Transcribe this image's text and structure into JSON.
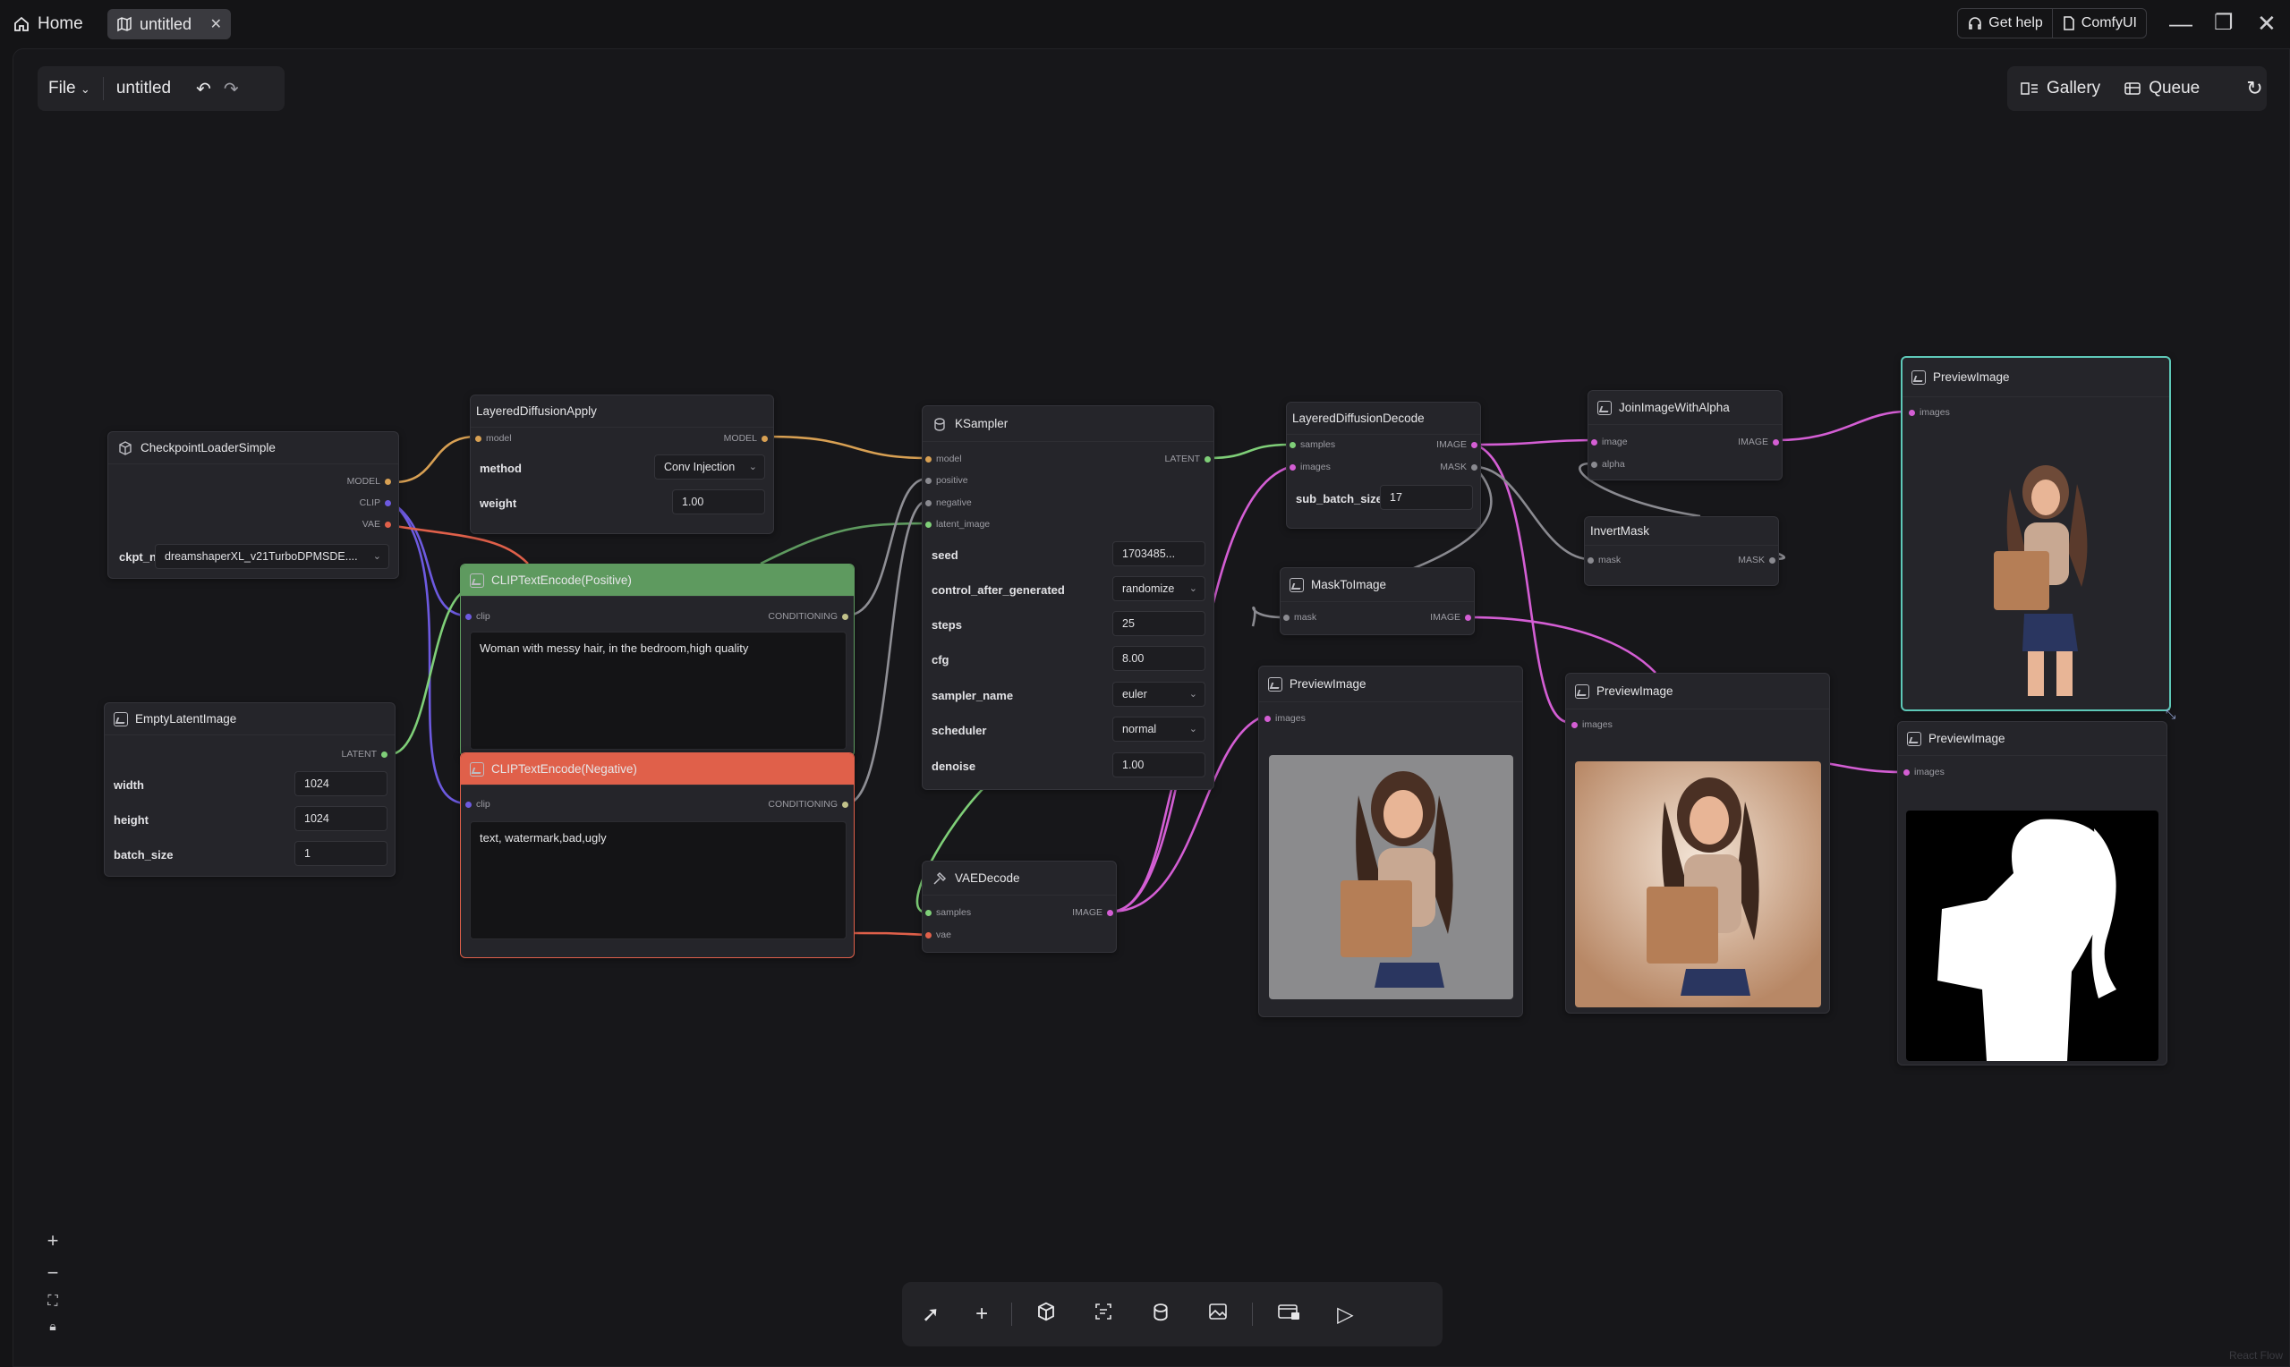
{
  "titlebar": {
    "home": "Home",
    "tab": "untitled",
    "help": "Get help",
    "app": "ComfyUI"
  },
  "menubar": {
    "file": "File",
    "workflow": "untitled"
  },
  "rightbar": {
    "gallery": "Gallery",
    "queue": "Queue"
  },
  "nodes": {
    "checkpoint": {
      "title": "CheckpointLoaderSimple",
      "out_model": "MODEL",
      "out_clip": "CLIP",
      "out_vae": "VAE",
      "widget": "ckpt_na",
      "value": "dreamshaperXL_v21TurboDPMSDE...."
    },
    "latent": {
      "title": "EmptyLatentImage",
      "out": "LATENT",
      "width_l": "width",
      "width": "1024",
      "height_l": "height",
      "height": "1024",
      "batch_l": "batch_size",
      "batch": "1"
    },
    "ldapply": {
      "title": "LayeredDiffusionApply",
      "in": "model",
      "out": "MODEL",
      "method_l": "method",
      "method": "Conv Injection",
      "weight_l": "weight",
      "weight": "1.00"
    },
    "pos": {
      "title": "CLIPTextEncode(Positive)",
      "in": "clip",
      "out": "CONDITIONING",
      "text": "Woman with messy hair, in the bedroom,high quality"
    },
    "neg": {
      "title": "CLIPTextEncode(Negative)",
      "in": "clip",
      "out": "CONDITIONING",
      "text": "text, watermark,bad,ugly"
    },
    "ksampler": {
      "title": "KSampler",
      "in_model": "model",
      "in_pos": "positive",
      "in_neg": "negative",
      "in_latent": "latent_image",
      "out": "LATENT",
      "seed_l": "seed",
      "seed": "1703485...",
      "ctrl_l": "control_after_generated",
      "ctrl": "randomize",
      "steps_l": "steps",
      "steps": "25",
      "cfg_l": "cfg",
      "cfg": "8.00",
      "sampler_l": "sampler_name",
      "sampler": "euler",
      "sched_l": "scheduler",
      "sched": "normal",
      "denoise_l": "denoise",
      "denoise": "1.00"
    },
    "vaedecode": {
      "title": "VAEDecode",
      "in_samples": "samples",
      "in_vae": "vae",
      "out": "IMAGE"
    },
    "lddecode": {
      "title": "LayeredDiffusionDecode",
      "in_samples": "samples",
      "in_images": "images",
      "out_image": "IMAGE",
      "out_mask": "MASK",
      "sub_l": "sub_batch_size",
      "sub": "17"
    },
    "masktoimage": {
      "title": "MaskToImage",
      "in": "mask",
      "out": "IMAGE"
    },
    "join": {
      "title": "JoinImageWithAlpha",
      "in_image": "image",
      "in_alpha": "alpha",
      "out": "IMAGE"
    },
    "invert": {
      "title": "InvertMask",
      "in": "mask",
      "out": "MASK"
    },
    "preview1": {
      "title": "PreviewImage",
      "in": "images"
    },
    "preview2": {
      "title": "PreviewImage",
      "in": "images"
    },
    "preview3": {
      "title": "PreviewImage",
      "in": "images"
    },
    "preview4": {
      "title": "PreviewImage",
      "in": "images"
    }
  },
  "colors": {
    "positive": "#5e9a5f",
    "negative": "#e0604a",
    "model": "#d8a053",
    "clip": "#6d5ae0",
    "vae": "#e0604a",
    "latent": "#7fcf78",
    "image": "#d45ed4",
    "mask": "#8a8a90",
    "conditioning": "#c2c28a",
    "selection": "#5ec8b8"
  },
  "watermark": "React Flow"
}
